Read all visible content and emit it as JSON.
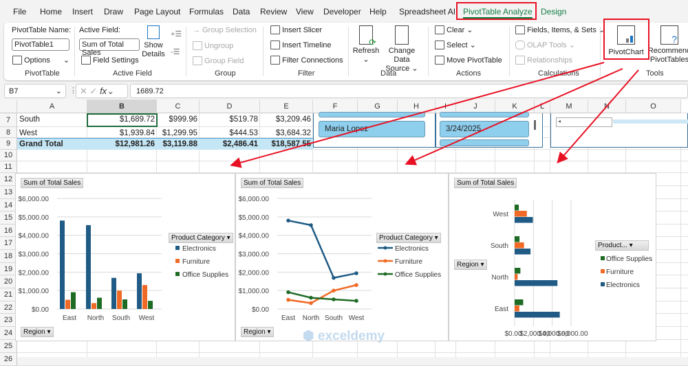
{
  "tabs": [
    "File",
    "Home",
    "Insert",
    "Draw",
    "Page Layout",
    "Formulas",
    "Data",
    "Review",
    "View",
    "Developer",
    "Help",
    "Spreadsheet AI",
    "PivotTable Analyze",
    "Design"
  ],
  "ribbon": {
    "pivottable": {
      "name_label": "PivotTable Name:",
      "name_value": "PivotTable1",
      "options": "Options",
      "group": "PivotTable"
    },
    "active_field": {
      "label": "Active Field:",
      "value": "Sum of Total Sales",
      "field_settings": "Field Settings",
      "show": "Show",
      "details": "Details",
      "group": "Active Field"
    },
    "group": {
      "group_selection": "Group Selection",
      "ungroup": "Ungroup",
      "group_field": "Group Field",
      "group": "Group"
    },
    "filter": {
      "insert_slicer": "Insert Slicer",
      "insert_timeline": "Insert Timeline",
      "filter_connections": "Filter Connections",
      "group": "Filter"
    },
    "data": {
      "refresh": "Refresh",
      "change_data": "Change Data",
      "source": "Source",
      "group": "Data"
    },
    "actions": {
      "clear": "Clear",
      "select": "Select",
      "move": "Move PivotTable",
      "group": "Actions"
    },
    "calculations": {
      "fields": "Fields, Items, & Sets",
      "olap": "OLAP Tools",
      "relationships": "Relationships",
      "group": "Calculations"
    },
    "tools": {
      "pivotchart": "PivotChart",
      "recommend1": "Recommend",
      "recommend2": "PivotTables",
      "group": "Tools"
    }
  },
  "formula_bar": {
    "name_box": "B7",
    "fx": "fx",
    "value": "1689.72"
  },
  "columns": [
    "A",
    "B",
    "C",
    "D",
    "E",
    "F",
    "G",
    "H",
    "I",
    "J",
    "K",
    "L",
    "M",
    "N",
    "O"
  ],
  "rows": [
    "7",
    "8",
    "9",
    "10",
    "11",
    "12",
    "13",
    "14",
    "15",
    "16",
    "17",
    "18",
    "19",
    "20",
    "21",
    "22",
    "23",
    "24",
    "25",
    "26"
  ],
  "table": [
    [
      "South",
      "$1,689.72",
      "$999.96",
      "$519.78",
      "$3,209.46"
    ],
    [
      "West",
      "$1,939.84",
      "$1,299.95",
      "$444.53",
      "$3,684.32"
    ],
    [
      "Grand Total",
      "$12,981.26",
      "$3,119.88",
      "$2,486.41",
      "$18,587.55"
    ]
  ],
  "slicers": {
    "name_item": "Maria Lopez",
    "date_item": "3/24/2025"
  },
  "watermark": "exceldemy",
  "colors": {
    "electronics": "#1f5b85",
    "furniture": "#f06a25",
    "office": "#1e6b24",
    "accent": "#107c41",
    "highlight": "#e81123"
  },
  "chart_data": [
    {
      "type": "bar",
      "orientation": "vertical",
      "title": "Sum of Total Sales",
      "axis_field": "Region",
      "legend_title": "Product Category",
      "legend_placement": "right",
      "categories": [
        "East",
        "North",
        "South",
        "West"
      ],
      "series": [
        {
          "name": "Electronics",
          "values": [
            4800,
            4551.7,
            1689.72,
            1939.84
          ]
        },
        {
          "name": "Furniture",
          "values": [
            500,
            319.97,
            999.96,
            1299.95
          ]
        },
        {
          "name": "Office Supplies",
          "values": [
            910,
            612.1,
            519.78,
            444.53
          ]
        }
      ],
      "yticks": [
        "$0.00",
        "$1,000.00",
        "$2,000.00",
        "$3,000.00",
        "$4,000.00",
        "$5,000.00",
        "$6,000.00"
      ],
      "ylim": [
        0,
        6000
      ],
      "grid": true
    },
    {
      "type": "line",
      "title": "Sum of Total Sales",
      "axis_field": "Region",
      "legend_title": "Product Category",
      "legend_placement": "right",
      "categories": [
        "East",
        "North",
        "South",
        "West"
      ],
      "series": [
        {
          "name": "Electronics",
          "values": [
            4800,
            4551.7,
            1689.72,
            1939.84
          ]
        },
        {
          "name": "Furniture",
          "values": [
            500,
            319.97,
            999.96,
            1299.95
          ]
        },
        {
          "name": "Office Supplies",
          "values": [
            910,
            612.1,
            519.78,
            444.53
          ]
        }
      ],
      "yticks": [
        "$0.00",
        "$1,000.00",
        "$2,000.00",
        "$3,000.00",
        "$4,000.00",
        "$5,000.00",
        "$6,000.00"
      ],
      "ylim": [
        0,
        6000
      ],
      "grid": true
    },
    {
      "type": "bar",
      "orientation": "horizontal",
      "title": "Sum of Total Sales",
      "axis_field": "Region",
      "legend_title": "Product...",
      "legend_placement": "right",
      "categories": [
        "East",
        "North",
        "South",
        "West"
      ],
      "series": [
        {
          "name": "Electronics",
          "values": [
            4800,
            4551.7,
            1689.72,
            1939.84
          ]
        },
        {
          "name": "Furniture",
          "values": [
            500,
            319.97,
            999.96,
            1299.95
          ]
        },
        {
          "name": "Office Supplies",
          "values": [
            910,
            612.1,
            519.78,
            444.53
          ]
        }
      ],
      "xticks": [
        "$0.00",
        "$2,000.00",
        "$4,000.00",
        "$6,000.00"
      ],
      "xlim": [
        0,
        6000
      ],
      "grid": true
    }
  ]
}
